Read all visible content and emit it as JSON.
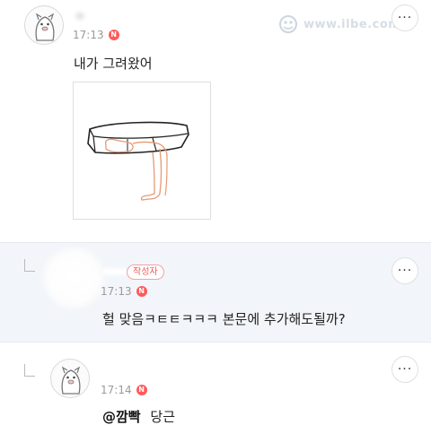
{
  "comments": [
    {
      "time": "17:13",
      "new_badge": "N",
      "text": "내가 그려왔어",
      "has_drawing": true
    },
    {
      "author_badge": "작성자",
      "time": "17:13",
      "new_badge": "N",
      "text": "헐 맞음ㅋㅌㅌㅋㅋㅋ 본문에 추가해도될까?"
    },
    {
      "time": "17:14",
      "new_badge": "N",
      "mention": "@깜빡",
      "text": "당근"
    }
  ],
  "more_button_label": "···",
  "watermark": "www.ilbe.com",
  "icons": {
    "avatar": "cartoon-avatar-icon",
    "reply": "reply-arrow-icon",
    "more": "more-options-icon"
  },
  "colors": {
    "new_badge": "#ff5a5a",
    "author_badge": "#ef5b5b",
    "reply_background": "#f2f5f9"
  }
}
